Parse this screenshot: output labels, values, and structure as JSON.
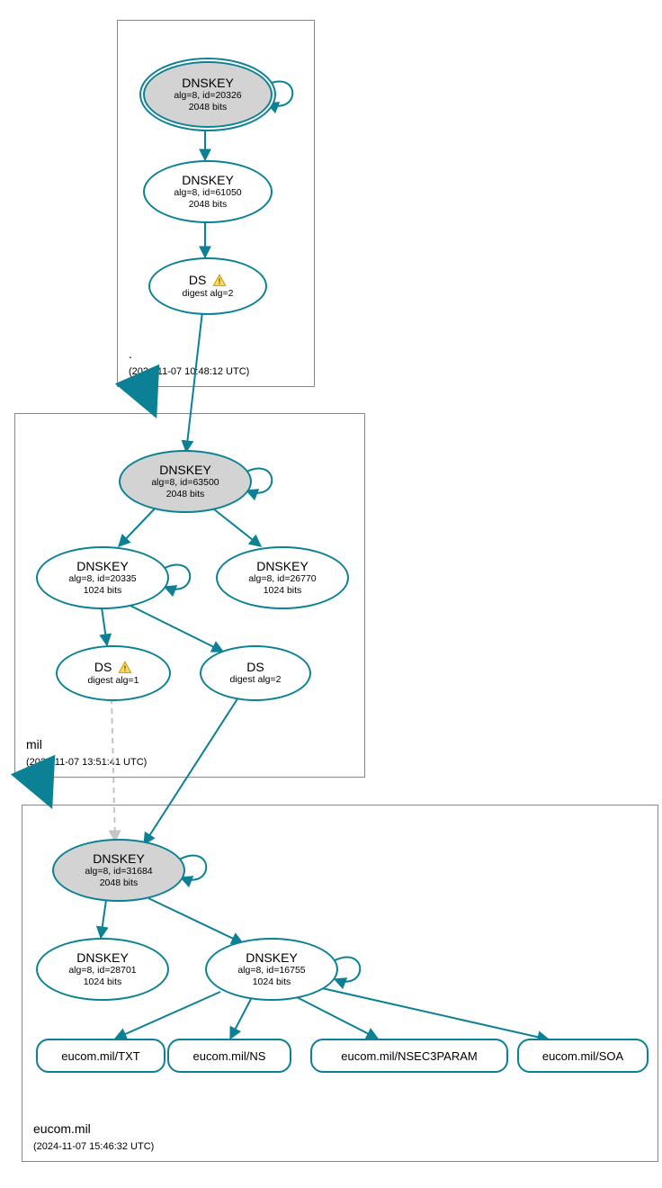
{
  "zones": {
    "root": {
      "label": ".",
      "time": "(2024-11-07 10:48:12 UTC)"
    },
    "mil": {
      "label": "mil",
      "time": "(2024-11-07 13:51:41 UTC)"
    },
    "eucom": {
      "label": "eucom.mil",
      "time": "(2024-11-07 15:46:32 UTC)"
    }
  },
  "nodes": {
    "root_ksk": {
      "title": "DNSKEY",
      "sub1": "alg=8, id=20326",
      "sub2": "2048 bits"
    },
    "root_zsk": {
      "title": "DNSKEY",
      "sub1": "alg=8, id=61050",
      "sub2": "2048 bits"
    },
    "root_ds": {
      "title": "DS",
      "sub1": "digest alg=2",
      "warn": true
    },
    "mil_ksk": {
      "title": "DNSKEY",
      "sub1": "alg=8, id=63500",
      "sub2": "2048 bits"
    },
    "mil_zsk": {
      "title": "DNSKEY",
      "sub1": "alg=8, id=20335",
      "sub2": "1024 bits"
    },
    "mil_zsk2": {
      "title": "DNSKEY",
      "sub1": "alg=8, id=26770",
      "sub2": "1024 bits"
    },
    "mil_ds1": {
      "title": "DS",
      "sub1": "digest alg=1",
      "warn": true
    },
    "mil_ds2": {
      "title": "DS",
      "sub1": "digest alg=2"
    },
    "eucom_ksk": {
      "title": "DNSKEY",
      "sub1": "alg=8, id=31684",
      "sub2": "2048 bits"
    },
    "eucom_zsk1": {
      "title": "DNSKEY",
      "sub1": "alg=8, id=28701",
      "sub2": "1024 bits"
    },
    "eucom_zsk2": {
      "title": "DNSKEY",
      "sub1": "alg=8, id=16755",
      "sub2": "1024 bits"
    }
  },
  "rrsets": {
    "txt": "eucom.mil/TXT",
    "ns": "eucom.mil/NS",
    "nsec3": "eucom.mil/NSEC3PARAM",
    "soa": "eucom.mil/SOA"
  }
}
